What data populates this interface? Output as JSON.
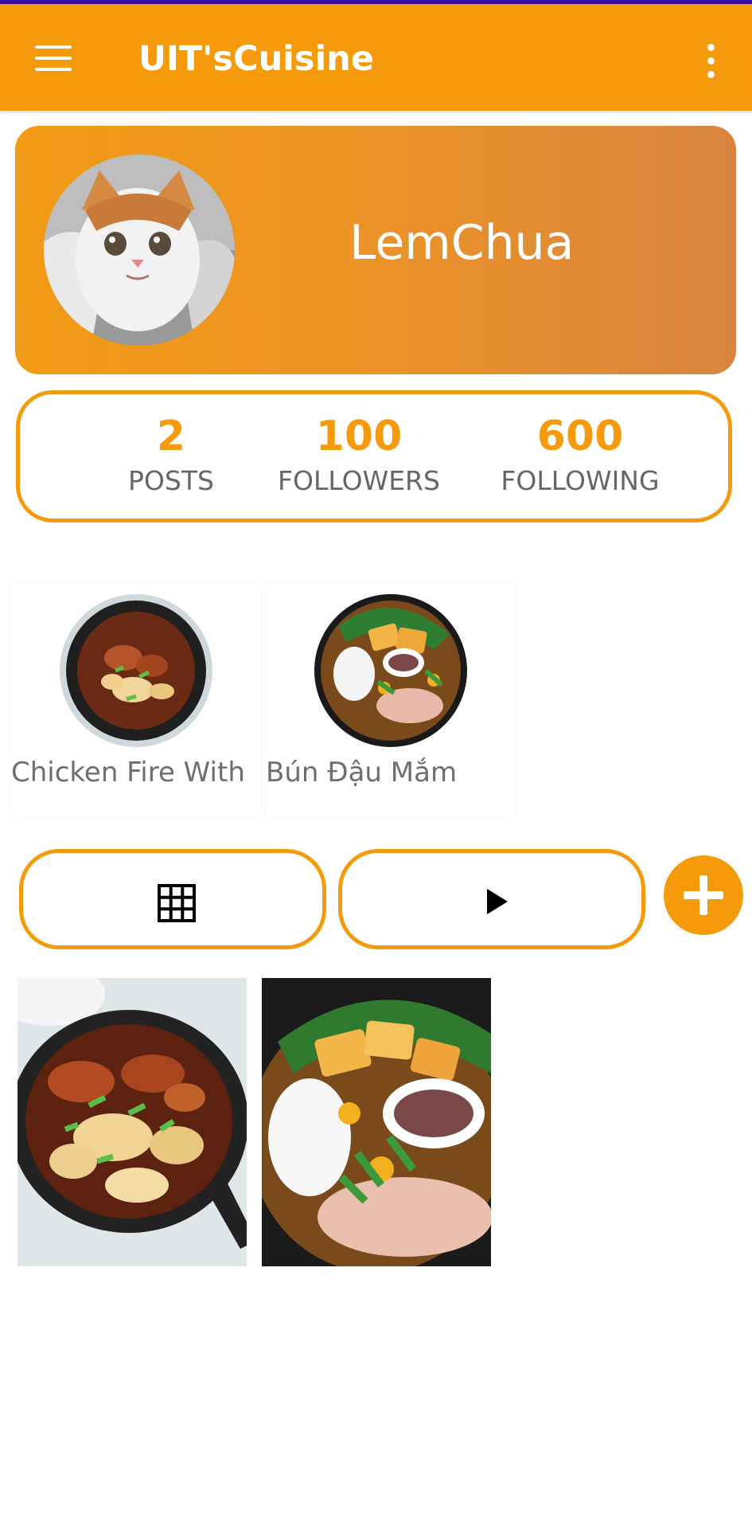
{
  "app": {
    "title": "UIT'sCuisine",
    "brand_color": "#f59a0b"
  },
  "header": {
    "menu_icon": "hamburger-menu-icon",
    "more_icon": "more-vert-icon"
  },
  "profile": {
    "username": "LemChua",
    "avatar": "cat-avatar"
  },
  "stats": [
    {
      "value": "2",
      "label": "POSTS"
    },
    {
      "value": "100",
      "label": "FOLLOWERS"
    },
    {
      "value": "600",
      "label": "FOLLOWING"
    }
  ],
  "recipes": [
    {
      "name": "Chicken Fire With",
      "image": "chicken-skillet"
    },
    {
      "name": "Bún Đậu Mắm",
      "image": "bun-dau-platter"
    }
  ],
  "tabs": [
    {
      "icon": "grid-icon"
    },
    {
      "icon": "play-icon"
    }
  ],
  "add_button": {
    "icon": "plus-icon"
  },
  "posts": [
    {
      "image": "chicken-skillet"
    },
    {
      "image": "bun-dau-platter"
    }
  ]
}
